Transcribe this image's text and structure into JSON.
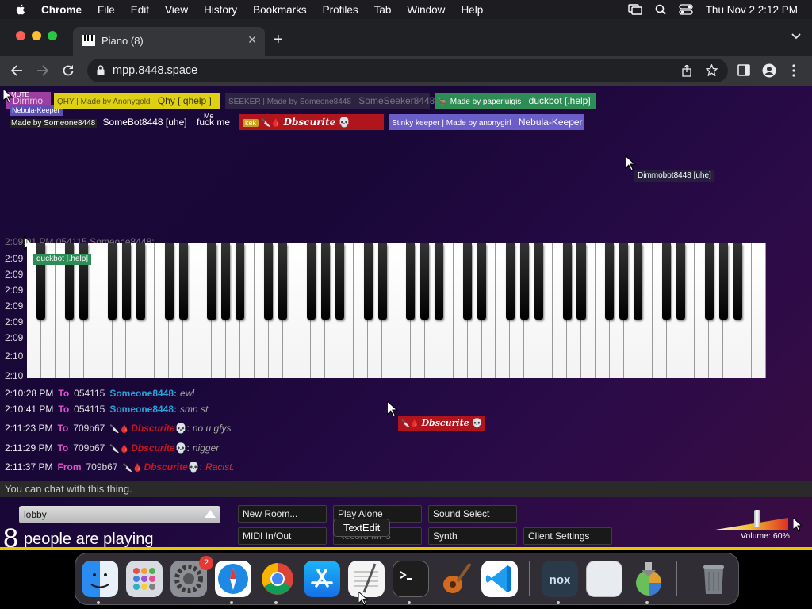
{
  "menubar": {
    "apple": "apple-icon",
    "app": "Chrome",
    "items": [
      "File",
      "Edit",
      "View",
      "History",
      "Bookmarks",
      "Profiles",
      "Tab",
      "Window",
      "Help"
    ],
    "datetime": "Thu Nov 2  2:12 PM"
  },
  "browser": {
    "tab_title": "Piano (8)",
    "new_tab": "+",
    "url": "mpp.8448.space"
  },
  "page": {
    "participants_row1": [
      {
        "tag": "MUTE",
        "name": "Dimmo",
        "color": "#9c3fa0"
      },
      {
        "tag": "QHY | Made by Anonygold",
        "name": "Qhy [ qhelp ]",
        "color": "#ded012"
      },
      {
        "tag": "SEEKER | Made by Someone8448",
        "name": "SomeSeeker8448",
        "color": "#3a3a48"
      },
      {
        "tag": "Made by paperluigis",
        "name": "duckbot [.help]",
        "color": "#2e8c56"
      }
    ],
    "participants_row2": [
      {
        "tag": "Made by Someone8448",
        "name": "SomeBot8448 [uhe]"
      },
      {
        "tag": "Me",
        "name": "fuck me"
      },
      {
        "tag": "kek",
        "name": "Dbscurite",
        "color": "#b0151d"
      },
      {
        "tag": "Stinky keeper | Made by anonygirl",
        "name": "Nebula-Keeper",
        "color": "#6c5ec8"
      }
    ],
    "small_tag_nebula": "Nebula-Keeper",
    "cursor_labels": {
      "dimmo": "Dimmobot8448 [uhe]",
      "duckbot": "duckbot [.help]",
      "dbscurite": "Dbscurite"
    },
    "piano_timestamps": [
      "2:09",
      "2:09",
      "2:09",
      "2:09",
      "2:09",
      "2:09",
      "2:10",
      "2:10"
    ],
    "chat_faded": "2:09:01 PM  054115  Someone8448:  ...",
    "chat": [
      {
        "time": "2:10:28 PM",
        "dir": "To",
        "id": "054115",
        "name": "Someone8448:",
        "msg": "ewl",
        "red": false
      },
      {
        "time": "2:10:41 PM",
        "dir": "To",
        "id": "054115",
        "name": "Someone8448:",
        "msg": "smn st",
        "red": false
      },
      {
        "time": "2:11:23 PM",
        "dir": "To",
        "id": "709b67",
        "name": "Dbscurite",
        "msg": "no u gfys",
        "red": true
      },
      {
        "time": "2:11:29 PM",
        "dir": "To",
        "id": "709b67",
        "name": "Dbscurite",
        "msg": "nigger",
        "red": true
      },
      {
        "time": "2:11:37 PM",
        "dir": "From",
        "id": "709b67",
        "name": "Dbscurite",
        "msg": "Racist.",
        "red": true
      }
    ],
    "chat_input_placeholder": "You can chat with this thing.",
    "room": "lobby",
    "player_count": "8",
    "player_label": "people are playing",
    "buttons": {
      "new_room": "New Room...",
      "play_alone": "Play Alone",
      "sound_select": "Sound Select",
      "midi": "MIDI In/Out",
      "record": "Record MP3",
      "synth": "Synth",
      "client_settings": "Client Settings"
    },
    "volume": "Volume: 60%",
    "volume_level": 0.6
  },
  "dock": {
    "tooltip": "TextEdit",
    "badge": "2",
    "apps": [
      "finder-icon",
      "launchpad-icon",
      "system-settings-icon",
      "safari-icon",
      "chrome-icon",
      "app-store-icon",
      "textedit-icon",
      "terminal-icon",
      "garageband-icon",
      "vscode-icon",
      "nox-icon",
      "preview-icon",
      "installer-icon",
      "trash-icon"
    ]
  }
}
